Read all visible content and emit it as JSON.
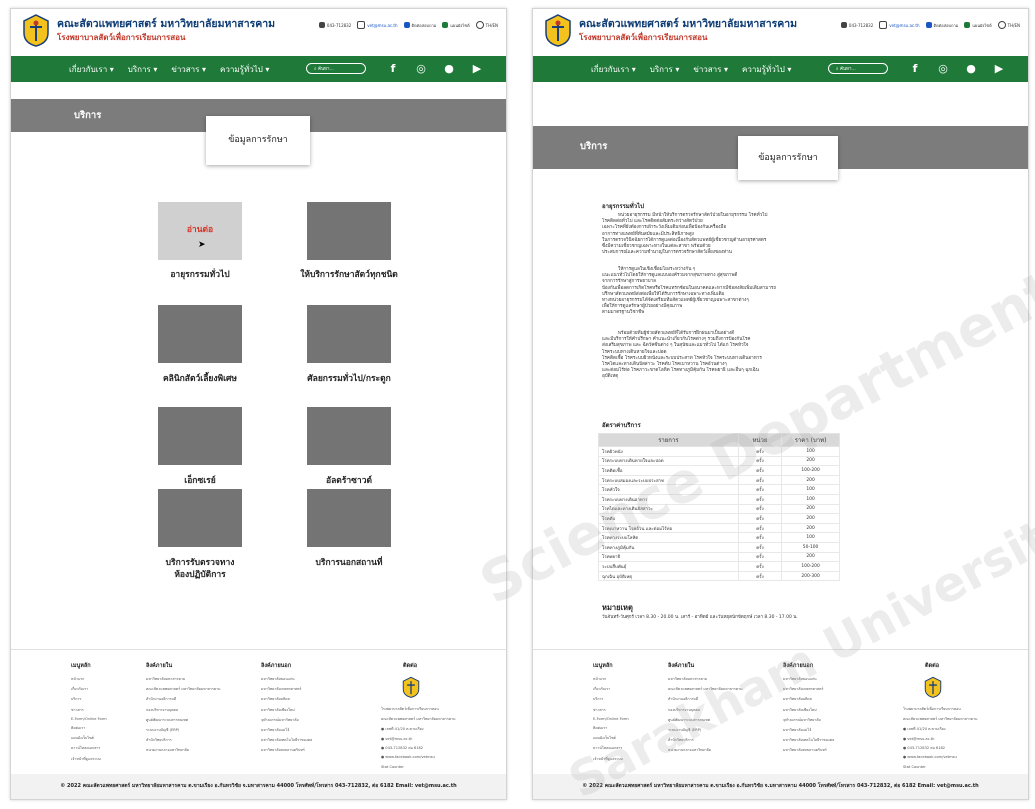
{
  "header": {
    "title": "คณะสัตวแพทยศาสตร์ มหาวิทยาลัยมหาสารคาม",
    "subtitle": "โรงพยาบาลสัตว์เพื่อการเรียนการสอน",
    "phone": "043-712832",
    "email": "vet@msu.ac.th",
    "line": "ติดต่อสอบถาม",
    "sitemap": "แผนผังไซต์",
    "lang": "TH/EN"
  },
  "nav": {
    "items": [
      "เกี่ยวกับเรา",
      "บริการ",
      "ข่าวสาร",
      "ความรู้ทั่วไป"
    ],
    "search_placeholder": "ค้นหา..."
  },
  "colors": {
    "nav_green": "#1f7a3a",
    "band_gray": "#7c7c7c",
    "read_more_red": "#d63226",
    "title_blue": "#0d3b74"
  },
  "left": {
    "band_label": "บริการ",
    "info_title": "ข้อมูลการรักษา",
    "read_more": "อ่านต่อ",
    "services": [
      "อายุรกรรมทั่วไป",
      "ให้บริการรักษาสัตว์ทุกชนิด",
      "คลินิกสัตว์เลี้ยงพิเศษ",
      "ศัลยกรรมทั่วไป/กระดูก",
      "เอ็กซเรย์",
      "อัลตร้าซาวด์",
      "บริการรับตรวจทาง",
      "ห้องปฏิบัติการ",
      "บริการนอกสถานที่"
    ]
  },
  "right": {
    "band_label": "บริการ",
    "info_title": "ข้อมูลการรักษา",
    "section_title": "อายุรกรรมทั่วไป",
    "para1": [
      "หน่วยอายุรกรรม มีหน้าให้บริการตรวจรักษาสัตว์ป่วยในอายุรกรรม โรคทั่วไป",
      "โรคติดต่อทั่วไป และโรคติดต่อสัมตระหว่างสัตว์ป่วย",
      "เฉพาะโรคที่ยังต้องการเฝ้าระวังเพิ่มเติมก่อนเพื่อป้องกันเครื่องมือ",
      "อาการทางแพทย์ที่ทันสมัยและมีประสิทธิภาพสูง",
      "ในการตรวจวินิจฉัยการได้การดูแลต่อเนื่องกับสัตวแพทย์ผู้เชี่ยวชาญด้านอายุรศาสตร",
      "ซึ่งมีความเชี่ยวชาญเฉพาะทางในแต่ละสาขา พร้อมด้วย",
      "ประสบการณ์และความชำนาญในการตรวจรักษาสัตว์เลี้ยงของท่าน"
    ],
    "para2": [
      "ให้การดูแลในเชิงเชื่อมโยงระหว่างกัน ๆ",
      "แนะแนวทั่วไปโดยให้การดูแลแบบองค์รวมจากสุขภาพทาง สู่สุขภาพดี",
      "จากการรักษาสู่การพยาบาล",
      "ป้องกันเพื่อลดการเกิดโรคหรือโรคแทรกซ้อนในอนาคตและหากมีข้อสงสัยเพิ่มเติมสามารถ",
      "ปรึกษาสัตวแพทย์ส่งต่อเพื่อให้ได้รับการรักษาเฉพาะทางเพิ่มเติม",
      "ทางหน่วยอายุรกรรมได้จัดเตรียมทีมสัตวแพทย์ผู้เชี่ยวชาญเฉพาะสาขาต่างๆ",
      "เพื่อให้การดูแลรักษาผู้ป่วยอย่างมีคุณภาพ",
      "ตามมาตรฐานวิชาชีพ"
    ],
    "para3": [
      "พร้อมด้วยทีมผู้ช่วยสัตวแพทย์ที่ได้รับการฝึกฝนมาเป็นอย่างดี",
      "และมีบริการให้คำปรึกษา คำแนะนำเกี่ยวกับโรคต่างๆ รวมถึงการป้องกันโรค",
      "ส่งเสริมสุขภาพ และ ฉีดวัคซีนต่าง ๆ ในสุนัขและแมวทั่วไป ได้แก่ โรคหัวใจ",
      "โรคระบบทางเดินหายใจและปอด",
      "โรคติดเชื้อ โรคระบบผิวหนังและระบบประสาท โรคหัวใจ โรคระบบทางเดินอาหาร",
      "โรคไตและทางเดินปัสสาวะ โรคตับ โรคเบาหวาน โรคอ้วนต่างๆ",
      "และต่อมไร้ท่อ โรคภาวะขาดโลหิต โรคทางภูมิคุ้มกัน โรคพยาธิ และอื่นๆ ฉุกเฉิน",
      "อุบัติเหตุ"
    ],
    "rate_title": "อัตราค่าบริการ",
    "rate_headers": [
      "รายการ",
      "หน่วย",
      "ราคา (บาท)"
    ],
    "rates": [
      [
        "โรคผิวหนัง",
        "ครั้ง",
        "100"
      ],
      [
        "โรคระบบทางเดินหายใจและปอด",
        "ครั้ง",
        "200"
      ],
      [
        "โรคติดเชื้อ",
        "ครั้ง",
        "100-200"
      ],
      [
        "โรคระบบสมองและระบบประสาท",
        "ครั้ง",
        "200"
      ],
      [
        "โรคหัวใจ",
        "ครั้ง",
        "100"
      ],
      [
        "โรคระบบทางเดินอาหาร",
        "ครั้ง",
        "100"
      ],
      [
        "โรคไตและทางเดินปัสสาวะ",
        "ครั้ง",
        "200"
      ],
      [
        "โรคตับ",
        "ครั้ง",
        "200"
      ],
      [
        "โรคเบาหวาน โรคอ้วน และต่อมไร้ท่อ",
        "ครั้ง",
        "200"
      ],
      [
        "โรคทางระบบโลหิต",
        "ครั้ง",
        "100"
      ],
      [
        "โรคทางภูมิคุ้มกัน",
        "ครั้ง",
        "50-100"
      ],
      [
        "โรคพยาธิ",
        "ครั้ง",
        "200"
      ],
      [
        "ระบบสืบพันธุ์",
        "ครั้ง",
        "100-200"
      ],
      [
        "ฉุกเฉิน อุบัติเหตุ",
        "ครั้ง",
        "200-300"
      ]
    ],
    "note_title": "หมายเหตุ",
    "note_text": "วันจันทร์-วันศุกร์ เวลา 8.30 - 20.00 น. เสาร์ - อาทิตย์ และวันหยุดนักขัตฤกษ์ เวลา 8.30 - 17.00 น."
  },
  "footer": {
    "col1_title": "เมนูหลัก",
    "col1_items": [
      "หน้าแรก",
      "เกี่ยวกับเรา",
      "บริการ",
      "ข่าวสาร",
      "E-Form/Online Form",
      "ติดต่อเรา",
      "แผนผังเว็บไซต์",
      "ดาวน์โหลดเอกสาร",
      "เจ้าหน้าที่ดูแลระบบ"
    ],
    "col2_title": "ลิงค์ภายใน",
    "col2_items": [
      "มหาวิทยาลัยมหาสารคาม",
      "คณะสัตวแพทยศาสตร์ มหาวิทยาลัยมหาสารคาม",
      "สำนักงานอธิการบดี",
      "กองบริหารงานบุคคล",
      "ศูนย์พัฒนาระบบสารสนเทศ",
      "ระบบงานบัญชี (ERP)",
      "สำนักวิทยบริการ",
      "หน่วยงานกลางมหาวิทยาลัย"
    ],
    "col3_title": "ลิงค์ภายนอก",
    "col3_items": [
      "มหาวิทยาลัยขอนแก่น",
      "มหาวิทยาลัยเกษตรศาสตร์",
      "มหาวิทยาลัยมหิดล",
      "มหาวิทยาลัยเชียงใหม่",
      "จุฬาลงกรณ์มหาวิทยาลัย",
      "มหาวิทยาลัยแม่โจ้",
      "มหาวิทยาลัยเทคโนโลยีราชมงคล",
      "มหาวิทยาลัยสงขลานครินทร์"
    ],
    "col4_title": "ติดต่อ",
    "address": "โรงพยาบาลสัตว์เพื่อการเรียนการสอน",
    "address2": "คณะสัตวแพทยศาสตร์ มหาวิทยาลัยมหาสารคาม",
    "contacts": [
      "เลขที่ 41/20 ต.ขามเรียง",
      "vet@msu.ac.th",
      "043-712832 ต่อ 6182",
      "www.facebook.com/vetmsu"
    ],
    "counter_label": "Stat Counter",
    "counter_badge": "0000000",
    "visitors": "จำนวนผู้เข้าชมเว็บไซต์",
    "visitors_link": "คลิก"
  },
  "bottom": "© 2022 คณะสัตวแพทยศาสตร์ มหาวิทยาลัยมหาสารคาม ต.ขามเรียง อ.กันทรวิชัย จ.มหาสารคาม 44000 โทรศัพท์/โทรสาร 043-712832, ต่อ 6182 Email: vet@msu.ac.th",
  "watermark": [
    "Science Department",
    "Sarakham University"
  ]
}
